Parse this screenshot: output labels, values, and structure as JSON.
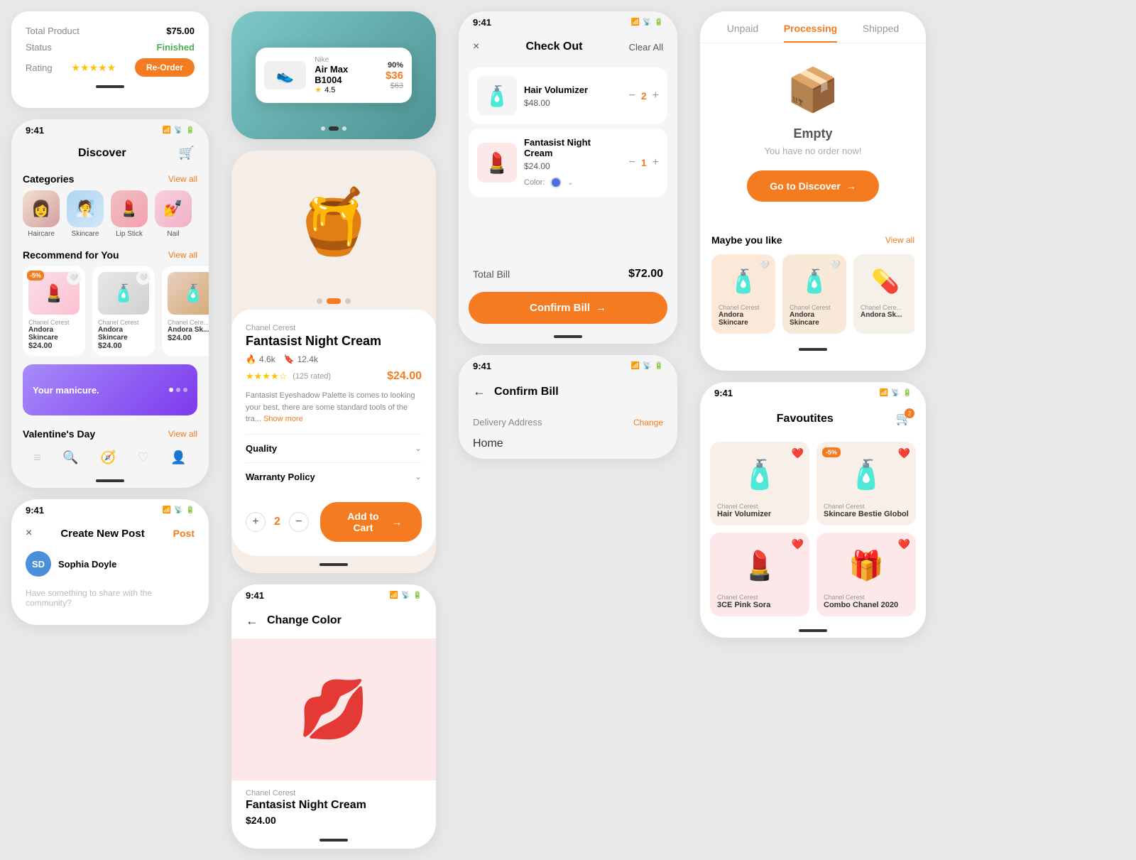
{
  "col1": {
    "order_card": {
      "total_product_label": "Total Product",
      "total_product_value": "$75.00",
      "status_label": "Status",
      "status_value": "Finished",
      "rating_label": "Rating",
      "reorder_btn": "Re-Order",
      "stars": "★★★★★"
    },
    "discover": {
      "title": "Discover",
      "categories_title": "Categories",
      "view_all": "View all",
      "recommend_title": "Recommend for You",
      "recommend_view_all": "View all",
      "valentine_title": "Valentine's Day",
      "valentine_view_all": "View all",
      "categories": [
        {
          "label": "Haircare",
          "emoji": "👩",
          "color": "cat-img-haircare"
        },
        {
          "label": "Skincare",
          "emoji": "🧖",
          "color": "cat-img-skincare"
        },
        {
          "label": "Lip Stick",
          "emoji": "💄",
          "color": "cat-img-lipstick"
        },
        {
          "label": "Nail",
          "emoji": "💅",
          "color": "cat-img-nails"
        }
      ],
      "products": [
        {
          "brand": "Chanel Cerest",
          "name": "Andora Skincare",
          "price": "$24.00",
          "badge": "-5%",
          "color": "product-img-pink"
        },
        {
          "brand": "Chanel Cerest",
          "name": "Andora Skincare",
          "price": "$24.00",
          "color": "product-img-grey"
        },
        {
          "brand": "Chanel Cere...",
          "name": "Andora Sk...",
          "price": "$24.00",
          "color": "product-img-brown"
        }
      ]
    },
    "create_post": {
      "close": "×",
      "title": "Create New Post",
      "action": "Post",
      "user_name": "Sophia Doyle",
      "placeholder": "Have something to share with the community?"
    }
  },
  "col2": {
    "product_detail": {
      "brand": "Chanel Cerest",
      "name": "Fantasist Night Cream",
      "stats_likes": "4.6k",
      "stats_saves": "12.4k",
      "rating": "★★★★☆",
      "rating_count": "(125 rated)",
      "price": "$24.00",
      "desc": "Fantasist Eyeshadow Palette is comes to looking your best, there are some standard tools of the tra...",
      "show_more": "Show more",
      "quality_label": "Quality",
      "warranty_label": "Warranty Policy",
      "qty": "2",
      "add_cart_btn": "Add to Cart"
    },
    "change_color": {
      "back": "←",
      "title": "Change Color",
      "brand": "Chanel Cerest",
      "name": "Fantasist Night Cream",
      "price": "$24.00"
    }
  },
  "col3": {
    "checkout": {
      "close": "×",
      "title": "Check Out",
      "clear_all": "Clear All",
      "items": [
        {
          "name": "Hair Volumizer",
          "price": "$48.00",
          "qty": "2",
          "emoji": "🧴"
        },
        {
          "name": "Fantasist Night Cream",
          "price": "$24.00",
          "qty": "1",
          "emoji": "💄",
          "has_color": true,
          "color": "blue"
        }
      ],
      "total_label": "Total Bill",
      "total_amount": "$72.00",
      "confirm_btn": "Confirm Bill"
    },
    "confirm_bill": {
      "back": "←",
      "title": "Confirm Bill",
      "delivery_label": "Delivery Address",
      "delivery_change": "Change",
      "delivery_value": "Home"
    }
  },
  "col4": {
    "orders": {
      "tabs": [
        "Unpaid",
        "Processing",
        "Shipped"
      ],
      "active_tab": "Processing",
      "empty_title": "Empty",
      "empty_sub": "You have no order now!",
      "go_discover_btn": "Go to Discover"
    },
    "maybe_like": {
      "title": "Maybe you like",
      "view_all": "View all",
      "products": [
        {
          "brand": "Chanel Cerest",
          "name": "Andora Skincare",
          "emoji": "🧴",
          "color": "#fce8d8"
        },
        {
          "brand": "Chanel Cerest",
          "name": "Andora Skincare",
          "emoji": "🧴",
          "color": "#f8e8d8"
        },
        {
          "brand": "Chanel Cere...",
          "name": "Andora Sk...",
          "emoji": "💊",
          "color": "#f5f0e8"
        }
      ]
    },
    "favourites": {
      "title": "Favoutites",
      "cart_badge": "2",
      "products": [
        {
          "brand": "Chanel Cerest",
          "name": "Hair Volumizer",
          "emoji": "🧴",
          "has_heart": true,
          "color": "#f8f0e8"
        },
        {
          "brand": "Chanel Cerest",
          "name": "Skincare Bestie Globol",
          "emoji": "🧴",
          "has_heart": true,
          "badge": "-5%",
          "color": "#f8f0e8"
        },
        {
          "brand": "Chanel Cerest",
          "name": "3CE Pink Sora",
          "emoji": "💄",
          "has_heart": true,
          "color": "#fce8e8"
        },
        {
          "brand": "Chanel Cerest",
          "name": "Combo Chanel 2020",
          "emoji": "🎁",
          "has_heart": true,
          "color": "#fce8e8"
        }
      ]
    }
  },
  "shoe_section": {
    "brand": "Nike",
    "name": "Air Max B1004",
    "rating": "4.5",
    "original_price": "$63",
    "sale_price": "$36",
    "discount_pct": "90%"
  },
  "colors": {
    "primary": "#F47B20",
    "star": "#FFC107",
    "green": "#4CAF50"
  }
}
